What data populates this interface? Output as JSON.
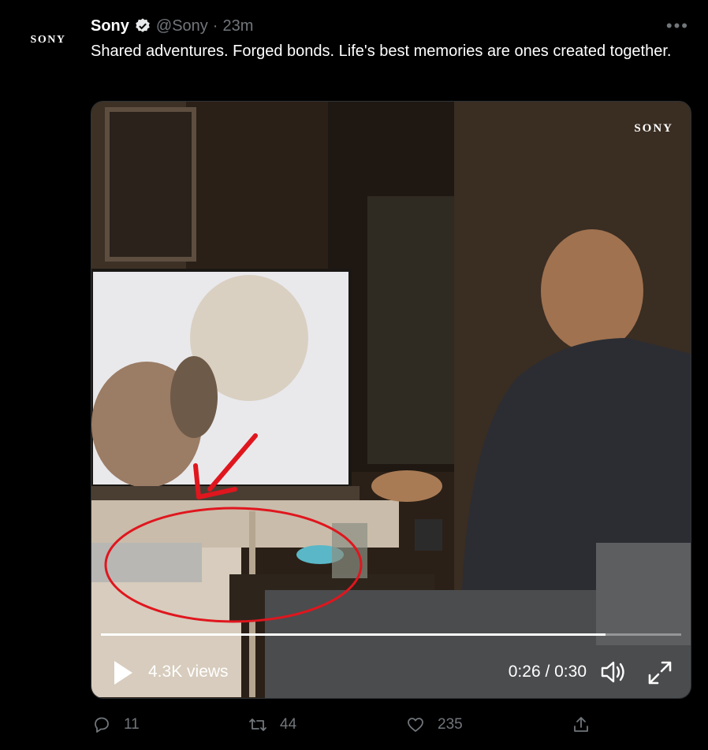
{
  "author": {
    "avatar_text": "SONY",
    "name": "Sony",
    "handle": "@Sony",
    "separator": "·",
    "time": "23m"
  },
  "more_label": "•••",
  "tweet": {
    "text": "Shared adventures. Forged bonds. Life's best memories are ones created together."
  },
  "media": {
    "watermark": "SONY",
    "views": "4.3K views",
    "timecode": "0:26 / 0:30",
    "progress": 0.87
  },
  "actions": {
    "reply_count": "11",
    "retweet_count": "44",
    "like_count": "235"
  },
  "colors": {
    "background": "#000000",
    "text": "#e7e9ea",
    "muted": "#71767b",
    "annotation": "#e0161e"
  }
}
